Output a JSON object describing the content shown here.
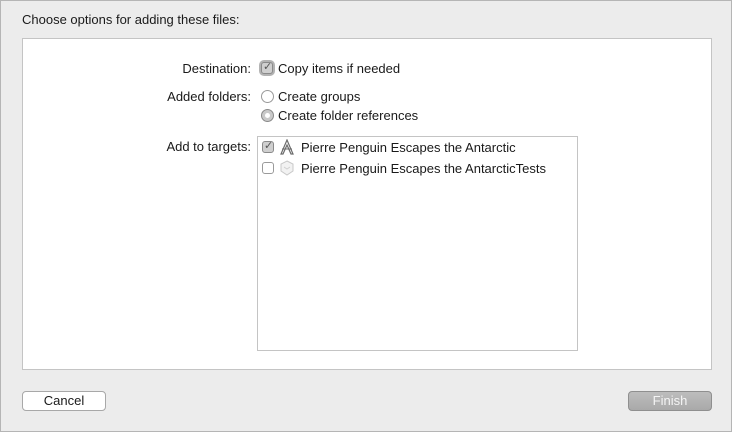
{
  "dialog": {
    "header": "Choose options for adding these files:"
  },
  "destination": {
    "label": "Destination:",
    "option_label": "Copy items if needed",
    "checked": true
  },
  "added_folders": {
    "label": "Added folders:",
    "options": [
      {
        "label": "Create groups",
        "selected": false
      },
      {
        "label": "Create folder references",
        "selected": true
      }
    ]
  },
  "targets": {
    "label": "Add to targets:",
    "items": [
      {
        "label": "Pierre Penguin Escapes the Antarctic",
        "checked": true,
        "icon": "app-icon"
      },
      {
        "label": "Pierre Penguin Escapes the AntarcticTests",
        "checked": false,
        "icon": "test-bundle-icon"
      }
    ]
  },
  "buttons": {
    "cancel": "Cancel",
    "finish": "Finish"
  }
}
